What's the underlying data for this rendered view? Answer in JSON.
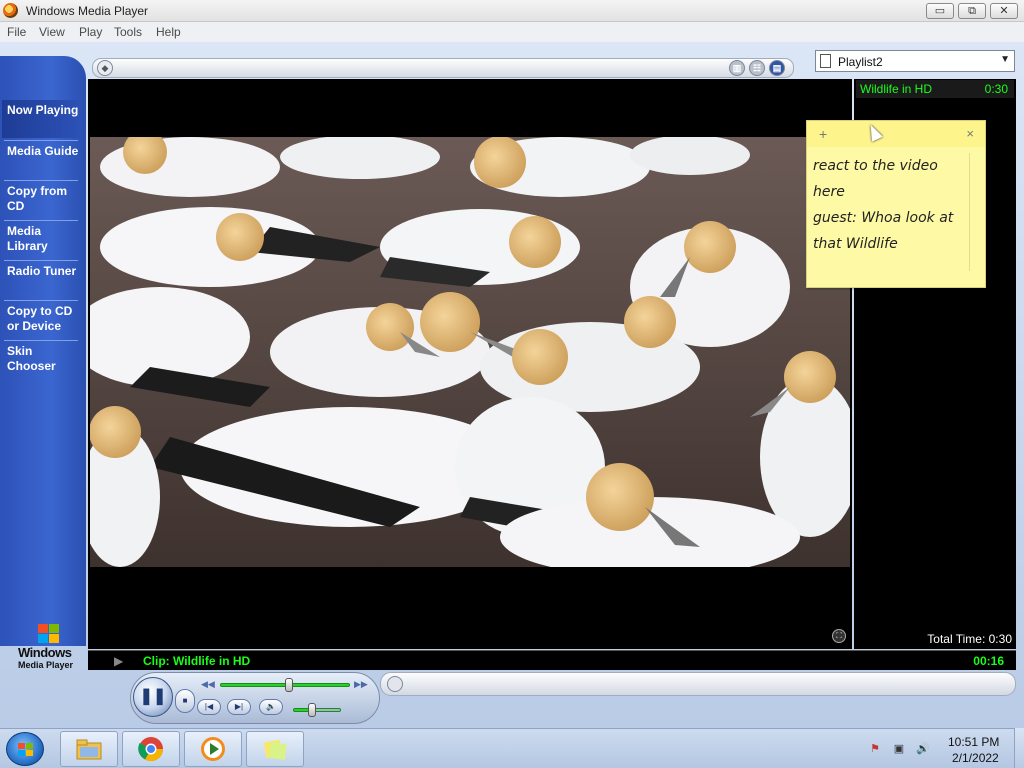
{
  "window": {
    "title": "Windows Media Player",
    "min_label": "▭",
    "max_label": "⧉",
    "close_label": "✕"
  },
  "menu": {
    "items": [
      "File",
      "View",
      "Play",
      "Tools",
      "Help"
    ]
  },
  "taskpane": {
    "items": [
      {
        "label": "Now Playing",
        "active": true
      },
      {
        "label": "Media Guide",
        "active": false
      },
      {
        "label": "Copy from CD",
        "active": false
      },
      {
        "label": "Media Library",
        "active": false
      },
      {
        "label": "Radio Tuner",
        "active": false
      },
      {
        "label": "Copy to CD or Device",
        "active": false
      },
      {
        "label": "Skin Chooser",
        "active": false
      }
    ],
    "logo_line1": "Windows",
    "logo_line2": "Media Player"
  },
  "playlist": {
    "name": "Playlist2",
    "items": [
      {
        "title": "Wildlife in HD",
        "duration": "0:30"
      }
    ],
    "total_time": "Total Time: 0:30"
  },
  "status": {
    "clip": "Clip: Wildlife in HD",
    "elapsed": "00:16",
    "progress_fraction": 0.53,
    "volume_fraction": 0.4
  },
  "sticky_note": {
    "text_line1": "react to the video here",
    "text_line2": "guest: Whoa look at that Wildlife",
    "add_label": "+",
    "close_label": "×"
  },
  "taskbar": {
    "apps": [
      "file-explorer",
      "chrome",
      "windows-media-player",
      "sticky-notes"
    ],
    "time": "10:51 PM",
    "date": "2/1/2022"
  },
  "colors": {
    "accent_green": "#19ff19",
    "taskpane_blue": "#2d52b8",
    "sticky_yellow": "#fef9a5"
  }
}
